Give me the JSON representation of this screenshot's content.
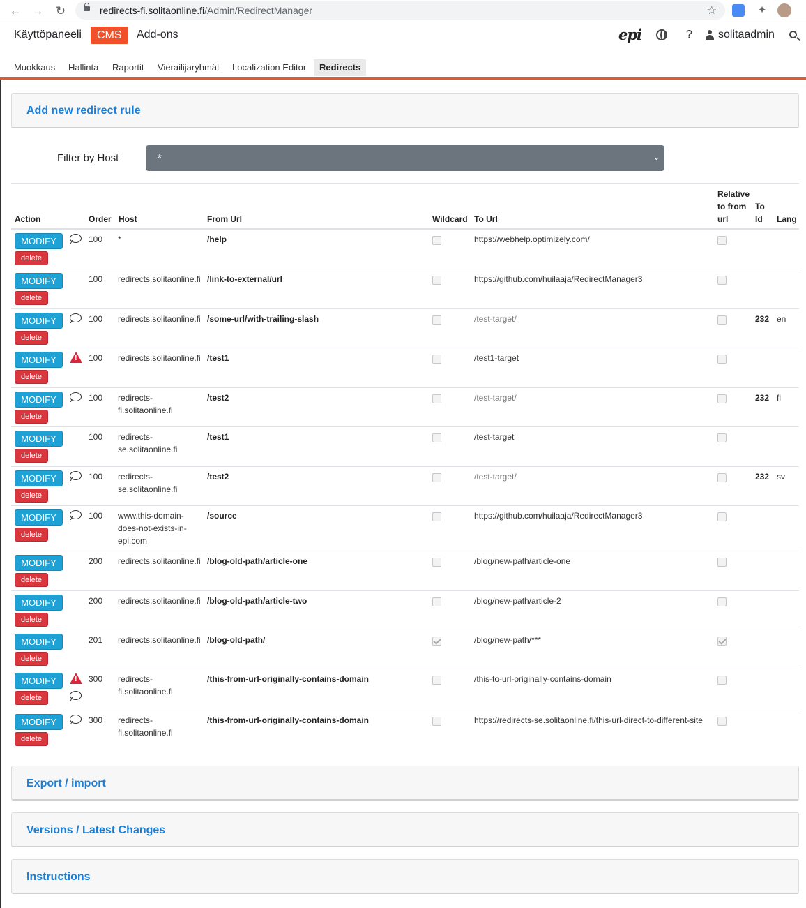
{
  "browser": {
    "url_host": "redirects-fi.solitaonline.fi",
    "url_path": "/Admin/RedirectManager"
  },
  "topbar": {
    "dashboard": "Käyttöpaneeli",
    "cms": "CMS",
    "addons": "Add-ons",
    "help": "?",
    "user": "solitaadmin"
  },
  "subnav": [
    "Muokkaus",
    "Hallinta",
    "Raportit",
    "Vierailijaryhmät",
    "Localization Editor",
    "Redirects"
  ],
  "add_panel": {
    "title": "Add new redirect rule"
  },
  "filter": {
    "label": "Filter by Host",
    "value": "*"
  },
  "table": {
    "headers": {
      "action": "Action",
      "order": "Order",
      "host": "Host",
      "from_url": "From Url",
      "wildcard": "Wildcard",
      "to_url": "To Url",
      "relative": "Relative to from url",
      "to_id": "To Id",
      "lang": "Lang"
    },
    "modify_label": "MODIFY",
    "delete_label": "delete",
    "rows": [
      {
        "order": "100",
        "host": "*",
        "from": "/help",
        "to": "https://webhelp.optimizely.com/",
        "to_gray": false,
        "wildcard": false,
        "relative": false,
        "to_id": "",
        "lang": "",
        "comment": true,
        "warning": false
      },
      {
        "order": "100",
        "host": "redirects.solitaonline.fi",
        "from": "/link-to-external/url",
        "to": "https://github.com/huilaaja/RedirectManager3",
        "to_gray": false,
        "wildcard": false,
        "relative": false,
        "to_id": "",
        "lang": "",
        "comment": false,
        "warning": false
      },
      {
        "order": "100",
        "host": "redirects.solitaonline.fi",
        "from": "/some-url/with-trailing-slash",
        "to": "/test-target/",
        "to_gray": true,
        "wildcard": false,
        "relative": false,
        "to_id": "232",
        "lang": "en",
        "comment": true,
        "warning": false
      },
      {
        "order": "100",
        "host": "redirects.solitaonline.fi",
        "from": "/test1",
        "to": "/test1-target",
        "to_gray": false,
        "wildcard": false,
        "relative": false,
        "to_id": "",
        "lang": "",
        "comment": false,
        "warning": true
      },
      {
        "order": "100",
        "host": "redirects-fi.solitaonline.fi",
        "from": "/test2",
        "to": "/test-target/",
        "to_gray": true,
        "wildcard": false,
        "relative": false,
        "to_id": "232",
        "lang": "fi",
        "comment": true,
        "warning": false
      },
      {
        "order": "100",
        "host": "redirects-se.solitaonline.fi",
        "from": "/test1",
        "to": "/test-target",
        "to_gray": false,
        "wildcard": false,
        "relative": false,
        "to_id": "",
        "lang": "",
        "comment": false,
        "warning": false
      },
      {
        "order": "100",
        "host": "redirects-se.solitaonline.fi",
        "from": "/test2",
        "to": "/test-target/",
        "to_gray": true,
        "wildcard": false,
        "relative": false,
        "to_id": "232",
        "lang": "sv",
        "comment": true,
        "warning": false
      },
      {
        "order": "100",
        "host": "www.this-domain-does-not-exists-in-epi.com",
        "from": "/source",
        "to": "https://github.com/huilaaja/RedirectManager3",
        "to_gray": false,
        "wildcard": false,
        "relative": false,
        "to_id": "",
        "lang": "",
        "comment": true,
        "warning": false
      },
      {
        "order": "200",
        "host": "redirects.solitaonline.fi",
        "from": "/blog-old-path/article-one",
        "to": "/blog/new-path/article-one",
        "to_gray": false,
        "wildcard": false,
        "relative": false,
        "to_id": "",
        "lang": "",
        "comment": false,
        "warning": false
      },
      {
        "order": "200",
        "host": "redirects.solitaonline.fi",
        "from": "/blog-old-path/article-two",
        "to": "/blog/new-path/article-2",
        "to_gray": false,
        "wildcard": false,
        "relative": false,
        "to_id": "",
        "lang": "",
        "comment": false,
        "warning": false
      },
      {
        "order": "201",
        "host": "redirects.solitaonline.fi",
        "from": "/blog-old-path/",
        "to": "/blog/new-path/***",
        "to_gray": false,
        "wildcard": true,
        "relative": true,
        "to_id": "",
        "lang": "",
        "comment": false,
        "warning": false
      },
      {
        "order": "300",
        "host": "redirects-fi.solitaonline.fi",
        "from": "/this-from-url-originally-contains-domain",
        "to": "/this-to-url-originally-contains-domain",
        "to_gray": false,
        "wildcard": false,
        "relative": false,
        "to_id": "",
        "lang": "",
        "comment": true,
        "warning": true
      },
      {
        "order": "300",
        "host": "redirects-fi.solitaonline.fi",
        "from": "/this-from-url-originally-contains-domain",
        "to": "https://redirects-se.solitaonline.fi/this-url-direct-to-different-site",
        "to_gray": false,
        "wildcard": false,
        "relative": false,
        "to_id": "",
        "lang": "",
        "comment": true,
        "warning": false
      }
    ]
  },
  "bottom_panels": [
    "Export / import",
    "Versions / Latest Changes",
    "Instructions"
  ],
  "colors": {
    "accent": "#f0512a",
    "link": "#1a7fd8",
    "modify": "#1ea2d6",
    "delete": "#d9363e",
    "select": "#6c757d",
    "warning": "#d7263d"
  }
}
